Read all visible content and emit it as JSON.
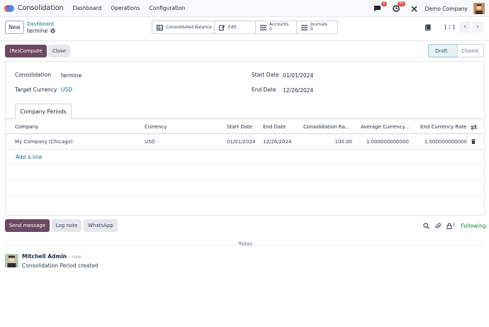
{
  "navbar": {
    "app_name": "Consolidation",
    "menu": [
      "Dashboard",
      "Operations",
      "Configuration"
    ],
    "messages_badge": "6",
    "activities_badge": "45",
    "company": "Demo Company"
  },
  "control": {
    "new_label": "New",
    "breadcrumb_parent": "Dashboard",
    "breadcrumb_current": "termine",
    "smart_buttons": {
      "balance": "Consolidated Balance",
      "edit": "Edit",
      "accounts_label": "Accounts",
      "accounts_count": "0",
      "journals_label": "Journals",
      "journals_count": "0"
    },
    "pager": "1 / 1"
  },
  "statusbar": {
    "recompute_label": "(Re)Compute",
    "close_label": "Close",
    "stages": [
      "Draft",
      "Closed"
    ],
    "active_stage": "Draft"
  },
  "form": {
    "consolidation_label": "Consolidation",
    "consolidation_value": "termine",
    "target_currency_label": "Target Currency",
    "target_currency_value": "USD",
    "start_date_label": "Start Date",
    "start_date_value": "01/01/2024",
    "end_date_label": "End Date",
    "end_date_value": "12/26/2024",
    "tab_label": "Company Periods",
    "columns": [
      "Company",
      "Currency",
      "Start Date",
      "End Date",
      "Consolidation Ra...",
      "Average Currency...",
      "End Currency Rate"
    ],
    "rows": [
      {
        "company": "My Company (Chicago)",
        "currency": "USD",
        "start_date": "01/01/2024",
        "end_date": "12/26/2024",
        "consolidation_rate": "100.00",
        "average_rate": "1.000000000000",
        "end_rate": "1.000000000000"
      }
    ],
    "add_line": "Add a line"
  },
  "chatter": {
    "send_message": "Send message",
    "log_note": "Log note",
    "whatsapp": "WhatsApp",
    "followers_count": "1",
    "following": "Following",
    "today": "Today",
    "message": {
      "author": "Mitchell Admin",
      "time": "- now",
      "body": "Consolidation Period created"
    }
  }
}
